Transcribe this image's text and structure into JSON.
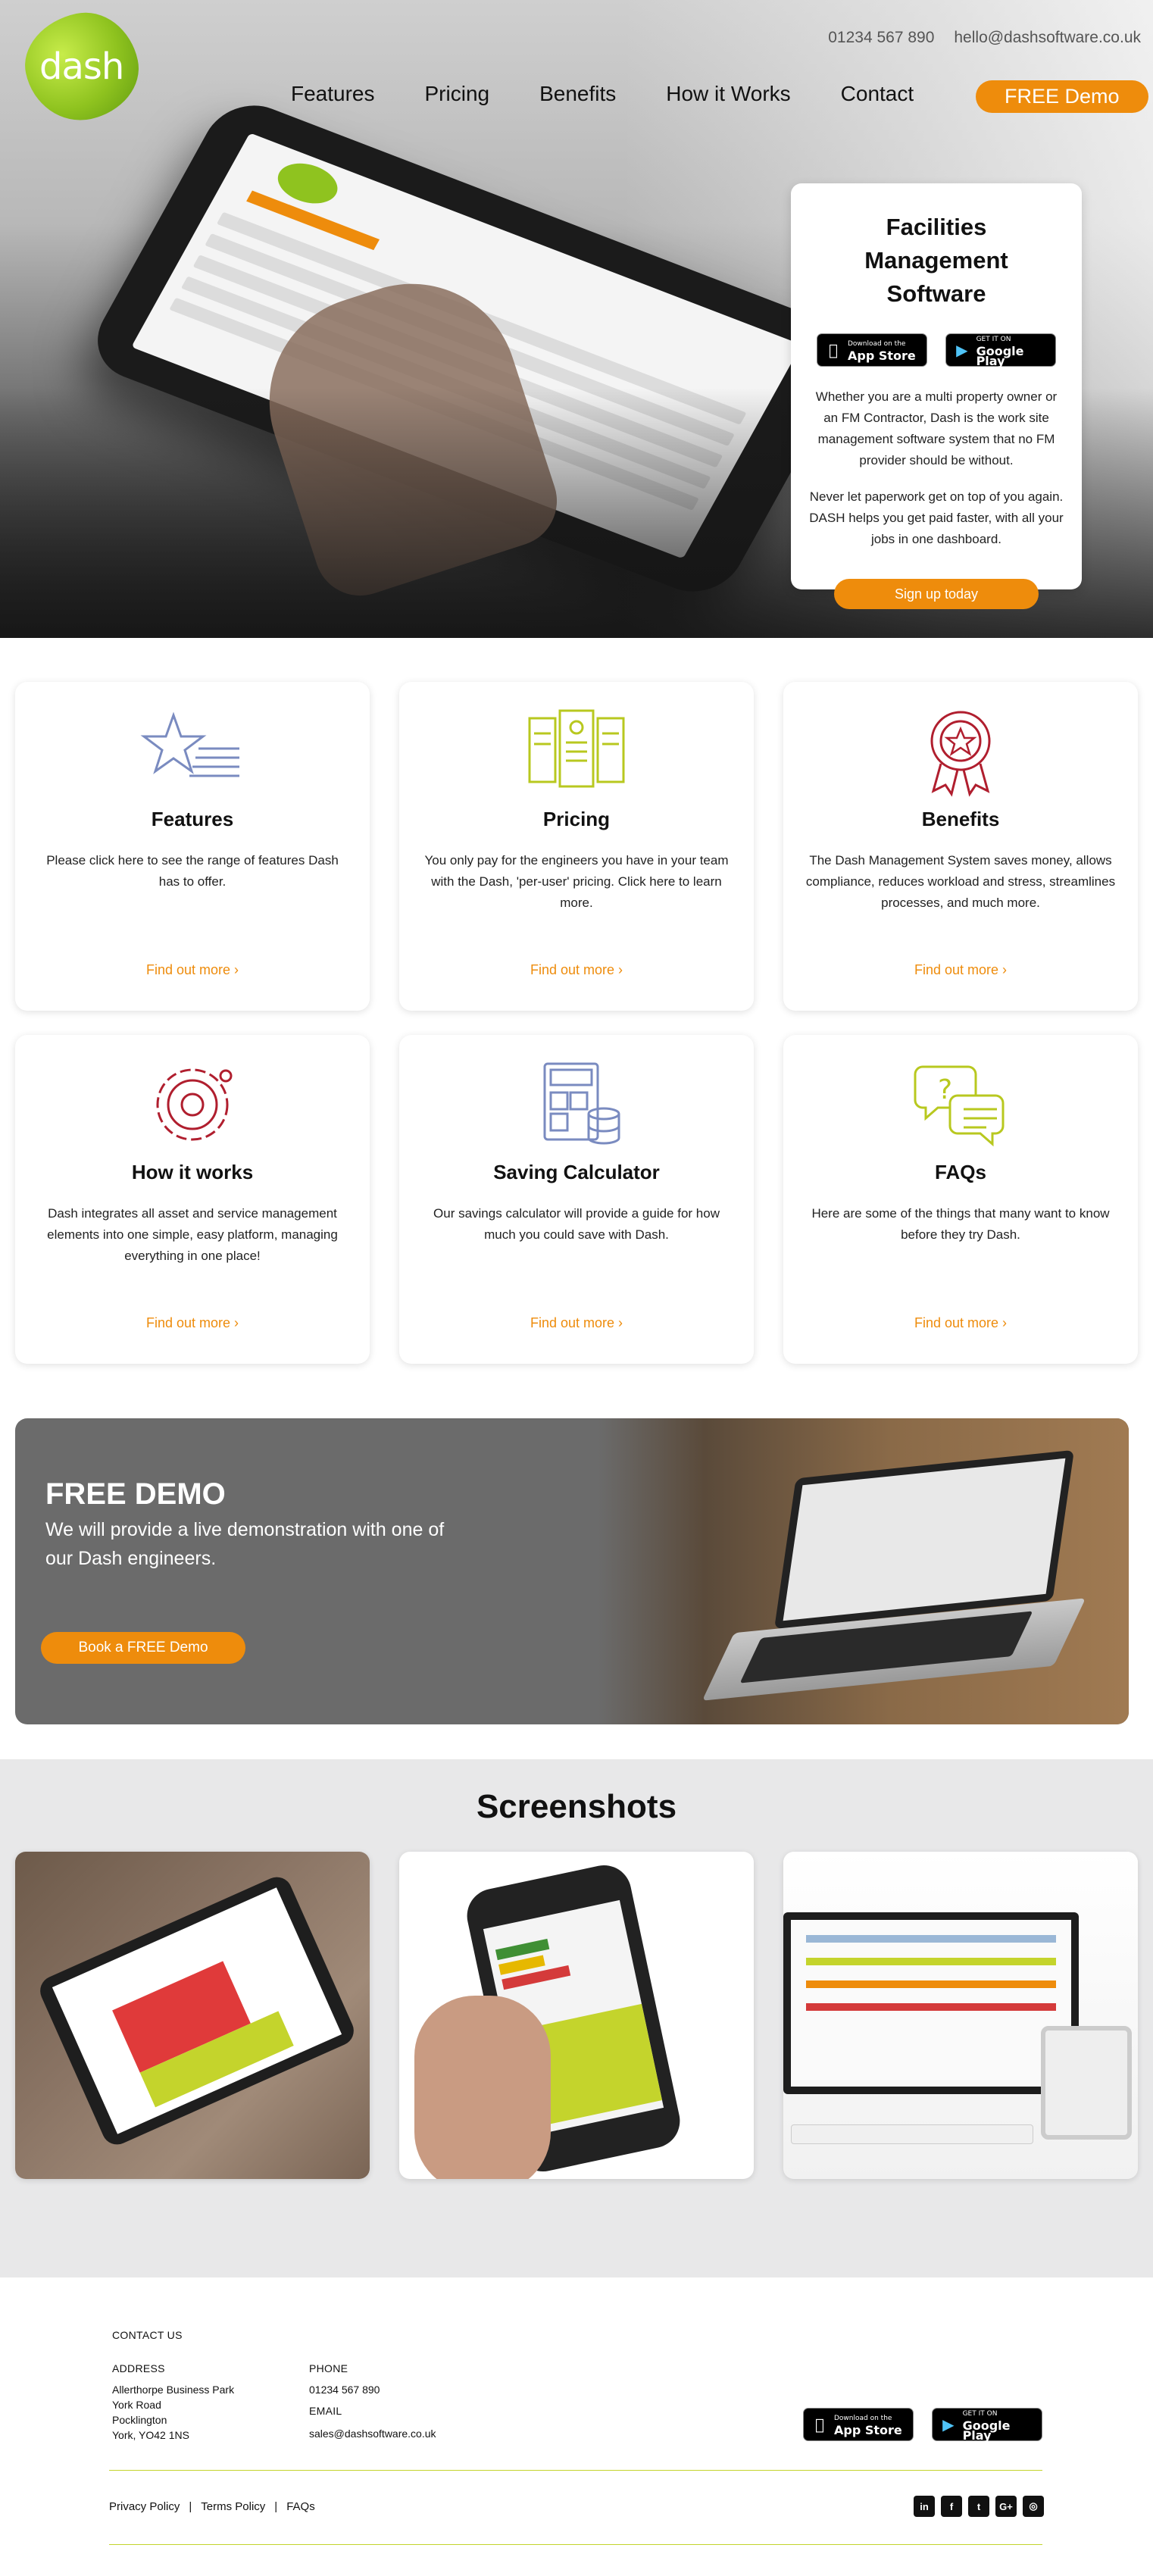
{
  "brand": {
    "logo_text": "dash",
    "accent": "#ee8c0c",
    "lime": "#8fc31f"
  },
  "header": {
    "phone": "01234 567 890",
    "email": "hello@dashsoftware.co.uk",
    "nav": [
      {
        "label": "Features"
      },
      {
        "label": "Pricing"
      },
      {
        "label": "Benefits"
      },
      {
        "label": "How it Works"
      },
      {
        "label": "Contact"
      }
    ],
    "demo_button": "FREE Demo"
  },
  "hero": {
    "title": "Facilities Management Software",
    "app_store": {
      "small": "Download on the",
      "big": "App Store",
      "icon": "apple-icon"
    },
    "google_play": {
      "small": "GET IT ON",
      "big": "Google Play",
      "icon": "play-icon"
    },
    "paragraph1": "Whether you are a multi property owner or an FM Contractor, Dash is the work site management software system that no FM provider should be without.",
    "paragraph2": "Never let paperwork get on top of you again. DASH helps you get paid faster, with all your jobs in one dashboard.",
    "cta": "Sign up today"
  },
  "cards": [
    {
      "icon": "star-list-icon",
      "title": "Features",
      "text": "Please click here to see the range of features Dash has to offer.",
      "link": "Find out more ›"
    },
    {
      "icon": "pricing-documents-icon",
      "title": "Pricing",
      "text": "You only pay for the engineers you have in your team with the Dash, 'per-user' pricing. Click here to learn more.",
      "link": "Find out more ›"
    },
    {
      "icon": "award-ribbon-icon",
      "title": "Benefits",
      "text": "The Dash Management System saves money, allows compliance, reduces workload and stress, streamlines processes, and much more.",
      "link": "Find out more ›"
    },
    {
      "icon": "gear-icon",
      "title": "How it works",
      "text": "Dash integrates all asset and service management elements into one simple, easy platform, managing everything in one place!",
      "link": "Find out more ›"
    },
    {
      "icon": "calculator-icon",
      "title": "Saving Calculator",
      "text": "Our savings calculator will provide a guide for how much you could save with Dash.",
      "link": "Find out more ›"
    },
    {
      "icon": "question-chat-icon",
      "title": "FAQs",
      "text": "Here are some of the things that many want to know before they try Dash.",
      "link": "Find out more ›"
    }
  ],
  "demo": {
    "title": "FREE DEMO",
    "text": "We will provide a live demonstration with one of our Dash engineers.",
    "button": "Book a FREE Demo"
  },
  "screenshots": {
    "title": "Screenshots"
  },
  "footer": {
    "contact_us": "CONTACT US",
    "address_label": "ADDRESS",
    "address_lines": [
      "Allerthorpe Business Park",
      "York Road",
      "Pocklington",
      "York, YO42 1NS"
    ],
    "phone_label": "PHONE",
    "phone": "01234 567 890",
    "email_label": "EMAIL",
    "email": "sales@dashsoftware.co.uk",
    "links": [
      "Privacy Policy",
      "|",
      "Terms Policy",
      "|",
      "FAQs"
    ],
    "social": [
      {
        "icon": "linkedin-icon",
        "glyph": "in"
      },
      {
        "icon": "facebook-icon",
        "glyph": "f"
      },
      {
        "icon": "twitter-icon",
        "glyph": "t"
      },
      {
        "icon": "google-plus-icon",
        "glyph": "G+"
      },
      {
        "icon": "instagram-icon",
        "glyph": "◎"
      }
    ]
  }
}
